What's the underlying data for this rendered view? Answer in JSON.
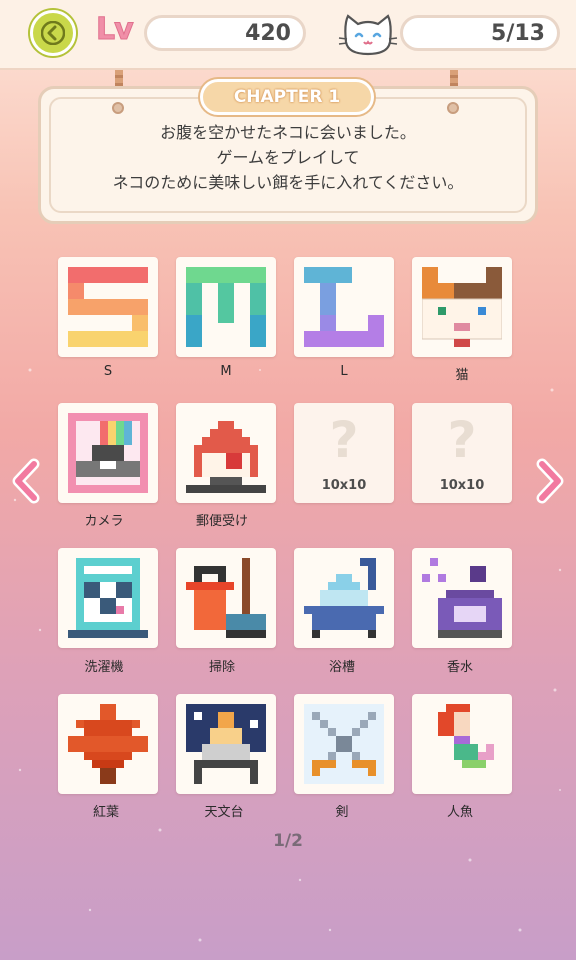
{
  "header": {
    "level_label": "Lv",
    "level_value": "420",
    "cats_value": "5/13"
  },
  "notice": {
    "chapter": "CHAPTER 1",
    "lines": [
      "お腹を空かせたネコに会いました。",
      "ゲームをプレイして",
      "ネコのために美味しい餌を手に入れてください。"
    ]
  },
  "puzzles": [
    {
      "label": "S",
      "icon": "letter-s-icon"
    },
    {
      "label": "M",
      "icon": "letter-m-icon"
    },
    {
      "label": "L",
      "icon": "letter-l-icon"
    },
    {
      "label": "猫",
      "icon": "cat-icon"
    },
    {
      "label": "カメラ",
      "icon": "camera-icon"
    },
    {
      "label": "郵便受け",
      "icon": "mailbox-icon"
    },
    {
      "label": "",
      "icon": "question-icon",
      "locked": true,
      "size": "10x10",
      "mark": "?"
    },
    {
      "label": "",
      "icon": "question-icon",
      "locked": true,
      "size": "10x10",
      "mark": "?"
    },
    {
      "label": "洗濯機",
      "icon": "washing-machine-icon"
    },
    {
      "label": "掃除",
      "icon": "cleaning-icon"
    },
    {
      "label": "浴槽",
      "icon": "bathtub-icon"
    },
    {
      "label": "香水",
      "icon": "perfume-icon"
    },
    {
      "label": "紅葉",
      "icon": "maple-leaf-icon"
    },
    {
      "label": "天文台",
      "icon": "observatory-icon"
    },
    {
      "label": "剣",
      "icon": "swords-icon"
    },
    {
      "label": "人魚",
      "icon": "mermaid-icon"
    }
  ],
  "pagination": {
    "text": "1/2"
  },
  "colors": {
    "accent_pink": "#f08fa8",
    "back_green": "#c9d84a",
    "tag_orange": "#f6d7a8"
  }
}
